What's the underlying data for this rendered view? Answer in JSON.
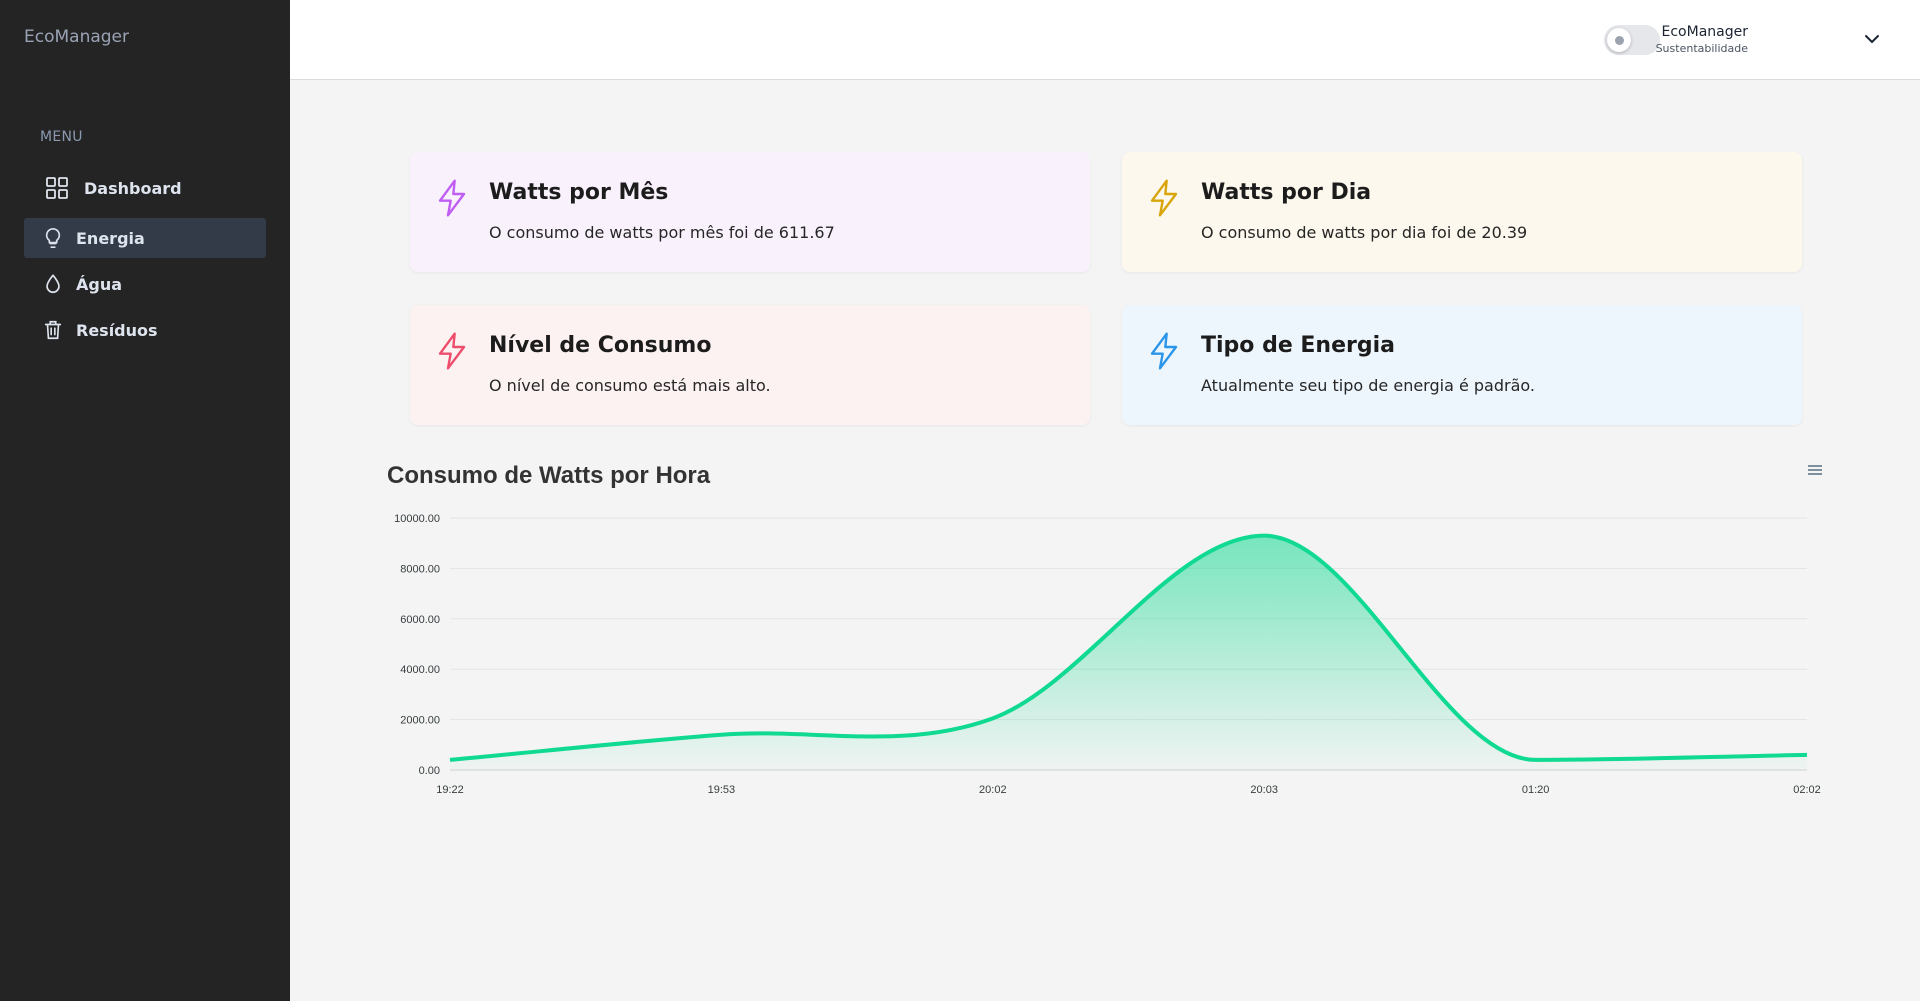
{
  "brand": "EcoManager",
  "menu_label": "MENU",
  "nav": [
    {
      "label": "Dashboard",
      "icon": "grid-icon"
    },
    {
      "label": "Energia",
      "icon": "lightbulb-icon"
    },
    {
      "label": "Água",
      "icon": "droplet-icon"
    },
    {
      "label": "Resíduos",
      "icon": "trash-icon"
    }
  ],
  "header": {
    "user_name": "EcoManager",
    "user_role": "Sustentabilidade",
    "theme_toggle": "off"
  },
  "cards": [
    {
      "title": "Watts por Mês",
      "desc": "O consumo de watts por mês foi de 611.67",
      "color": "#c05df3",
      "bg": "#f9f2fd"
    },
    {
      "title": "Watts por Dia",
      "desc": "O consumo de watts por dia foi de 20.39",
      "color": "#d8a50b",
      "bg": "#fcf8ed"
    },
    {
      "title": "Nível de Consumo",
      "desc": "O nível de consumo está mais alto.",
      "color": "#ee4e6c",
      "bg": "#fdf2f2"
    },
    {
      "title": "Tipo de Energia",
      "desc": "Atualmente seu tipo de energia é padrão.",
      "color": "#2b95ea",
      "bg": "#eef6fd"
    }
  ],
  "chart_title": "Consumo de Watts por Hora",
  "chart_data": {
    "type": "area",
    "title": "Consumo de Watts por Hora",
    "categories": [
      "19:22",
      "19:53",
      "20:02",
      "20:03",
      "01:20",
      "02:02"
    ],
    "series": [
      {
        "values": [
          400,
          1400,
          2050,
          9300,
          400,
          600
        ]
      }
    ],
    "ylim": [
      0,
      10000
    ],
    "yticks": [
      "0.00",
      "2000.00",
      "4000.00",
      "6000.00",
      "8000.00",
      "10000.00"
    ],
    "xlabel": "",
    "ylabel": "",
    "grid": true,
    "color": "#10d991"
  }
}
